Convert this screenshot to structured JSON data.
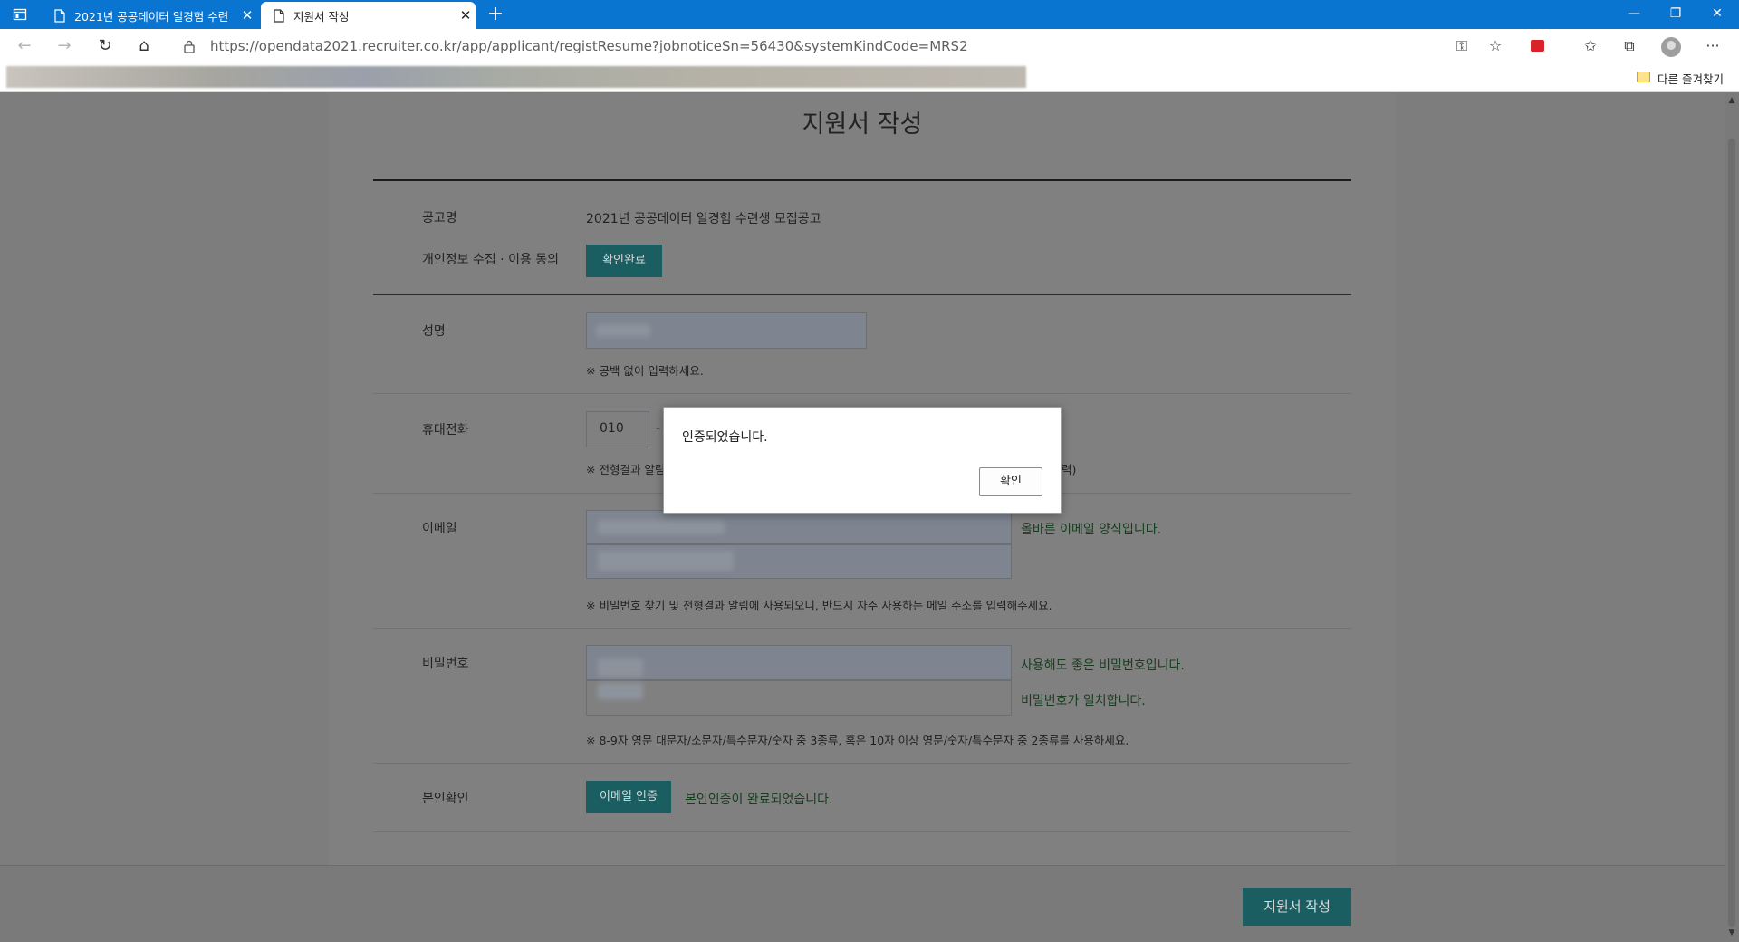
{
  "browser": {
    "tabs": [
      {
        "title": "2021년 공공데이터 일경험 수련",
        "active": false
      },
      {
        "title": "지원서 작성",
        "active": true
      }
    ],
    "new_tab": "+",
    "url": "https://opendata2021.recruiter.co.kr/app/applicant/registResume?jobnoticeSn=56430&systemKindCode=MRS2",
    "favorites_other": "다른 즐겨찾기",
    "tab_close": "✕",
    "more": "···"
  },
  "page": {
    "title": "지원서 작성",
    "notice_label": "공고명",
    "notice_value": "2021년 공공데이터 일경험 수련생 모집공고",
    "privacy_label": "개인정보 수집 · 이용 동의",
    "privacy_button": "확인완료",
    "name_label": "성명",
    "name_note": "※ 공백 없이 입력하세요.",
    "phone_label": "휴대전화",
    "phone_prefix": "010",
    "phone_dash": "-",
    "phone_note_left": "※ 전형결과 알림",
    "phone_note_right": "력)",
    "email_label": "이메일",
    "email_ok": "올바른 이메일 양식입니다.",
    "email_note": "※ 비밀번호 찾기 및 전형결과 알림에 사용되오니, 반드시 자주 사용하는 메일 주소를 입력해주세요.",
    "password_label": "비밀번호",
    "password_ok": "사용해도 좋은 비밀번호입니다.",
    "password_match": "비밀번호가 일치합니다.",
    "password_note": "※ 8-9자 영문 대문자/소문자/특수문자/숫자 중 3종류, 혹은 10자 이상 영문/숫자/특수문자 중 2종류를 사용하세요.",
    "verify_label": "본인확인",
    "verify_button": "이메일 인증",
    "verify_done": "본인인증이 완료되었습니다.",
    "submit_button": "지원서 작성"
  },
  "dialog": {
    "message": "인증되었습니다.",
    "ok_button": "확인"
  },
  "colors": {
    "tabbar": "#0a74d1",
    "teal_button": "#1b5e62",
    "overlay_page": "#7d7d7d"
  }
}
